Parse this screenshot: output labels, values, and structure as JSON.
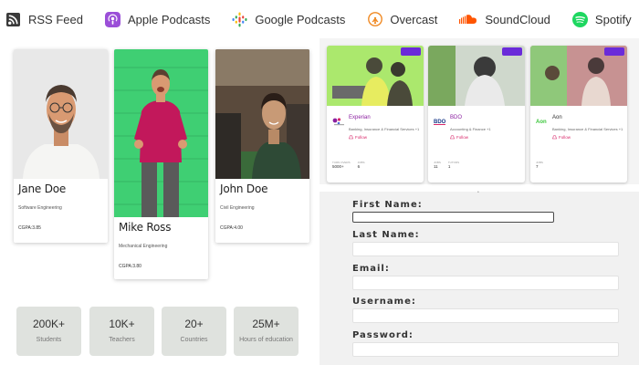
{
  "podcast_bar": {
    "items": [
      {
        "label": "RSS Feed",
        "icon": "rss-icon"
      },
      {
        "label": "Apple Podcasts",
        "icon": "apple-podcasts-icon"
      },
      {
        "label": "Google Podcasts",
        "icon": "google-podcasts-icon"
      },
      {
        "label": "Overcast",
        "icon": "overcast-icon"
      },
      {
        "label": "SoundCloud",
        "icon": "soundcloud-icon"
      },
      {
        "label": "Spotify",
        "icon": "spotify-icon"
      }
    ]
  },
  "profiles": [
    {
      "name": "Jane Doe",
      "department": "Software Engineering",
      "cgpa": "CGPA:3.85"
    },
    {
      "name": "Mike Ross",
      "department": "Mechanical Engineering",
      "cgpa": "CGPA:3.80"
    },
    {
      "name": "John Doe",
      "department": "Civil Engineering",
      "cgpa": "CGPA:4.00"
    }
  ],
  "stats": [
    {
      "value": "200K+",
      "label": "Students"
    },
    {
      "value": "10K+",
      "label": "Teachers"
    },
    {
      "value": "20+",
      "label": "Countries"
    },
    {
      "value": "25M+",
      "label": "Hours of education"
    }
  ],
  "companies": [
    {
      "name": "Experian",
      "sector": "Banking, Insurance & Financial Services +1",
      "follow": "Follow",
      "stat1_label": "TURN OVERS",
      "stat1_value": "5000+",
      "stat2_label": "JOBS",
      "stat2_value": "6"
    },
    {
      "name": "BDO",
      "sector": "Accounting & Finance +1",
      "follow": "Follow",
      "stat1_label": "JOBS",
      "stat1_value": "11",
      "stat2_label": "TUTORS",
      "stat2_value": "1"
    },
    {
      "name": "Aon",
      "sector": "Banking, Insurance & Financial Services +1",
      "follow": "Follow",
      "stat1_label": "JOBS",
      "stat1_value": "7",
      "stat2_label": "",
      "stat2_value": ""
    }
  ],
  "form": {
    "first_name_label": "First Name:",
    "last_name_label": "Last Name:",
    "email_label": "Email:",
    "username_label": "Username:",
    "password_label": "Password:",
    "first_name_value": "",
    "last_name_value": "",
    "email_value": "",
    "username_value": "",
    "password_value": ""
  },
  "colors": {
    "company_name": "#8b1fa0",
    "follow": "#d8286a",
    "company_tag": "#6a2bd9",
    "stat_box": "#dfe2de"
  }
}
